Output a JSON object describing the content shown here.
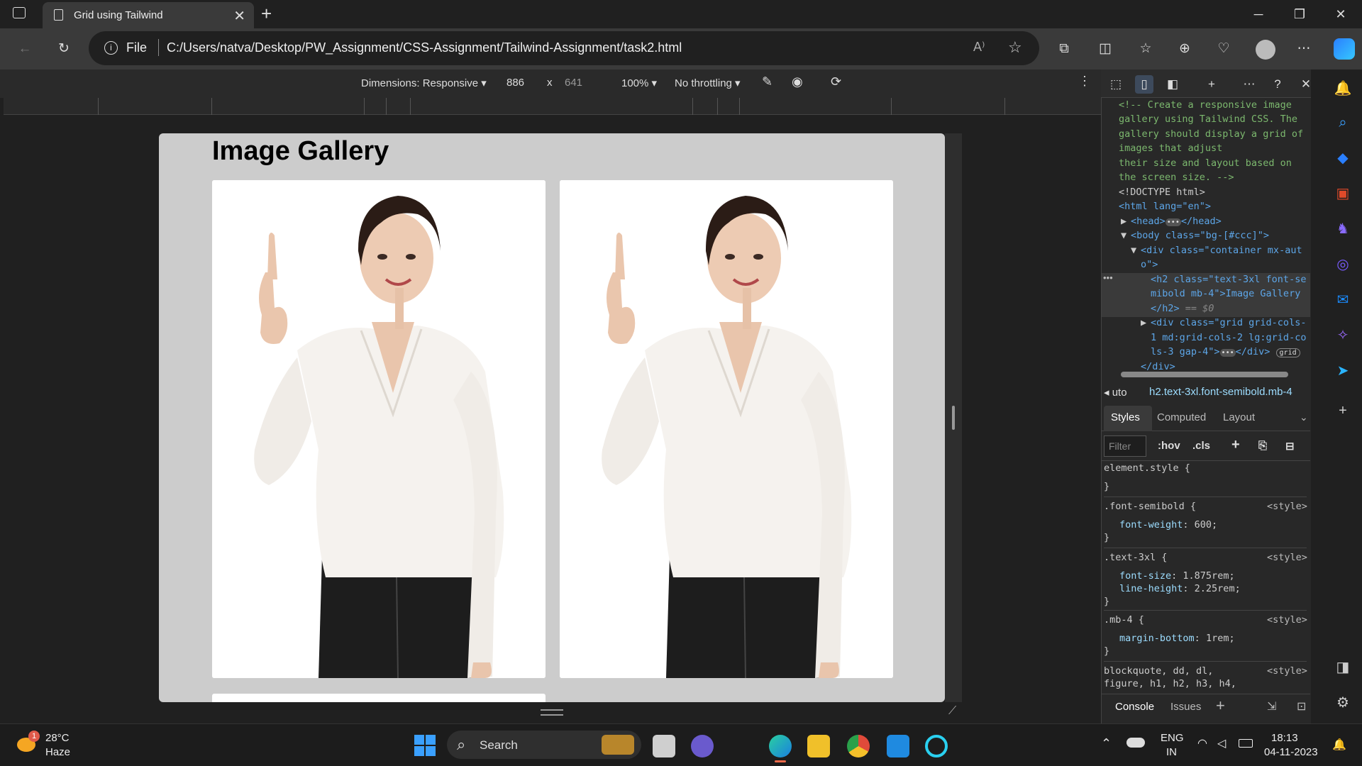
{
  "browser": {
    "tab_title": "Grid using Tailwind",
    "tab_close": "✕",
    "new_tab": "+",
    "file_label": "File",
    "url": "C:/Users/natva/Desktop/PW_Assignment/CSS-Assignment/Tailwind-Assignment/task2.html"
  },
  "device_toolbar": {
    "dimensions": "Dimensions: Responsive",
    "width": "886",
    "times": "x",
    "height": "641",
    "zoom": "100%",
    "throttling": "No throttling"
  },
  "page": {
    "title": "Image Gallery"
  },
  "devtools": {
    "code_lines": [
      "<!-- Create a responsive image",
      "gallery using Tailwind CSS. The",
      "gallery should display a grid of",
      "images that adjust",
      "their size and layout based on",
      "the screen size. -->"
    ],
    "doctype": "<!DOCTYPE html>",
    "html_tag": "<html lang=\"en\">",
    "head_tag": "<head>",
    "head_close": "</head>",
    "body_tag": "<body class=\"bg-[#ccc]\">",
    "div_tag_1": "<div class=\"container mx-aut",
    "div_tag_2": "o\">",
    "h2_line1": "<h2 class=\"text-3xl font-se",
    "h2_line2": "mibold mb-4\">Image Gallery",
    "h2_line3": "</h2>",
    "h2_eq": " == $0",
    "grid_line1": "<div class=\"grid grid-cols-",
    "grid_line2": "1 md:grid-cols-2 lg:grid-co",
    "grid_line3": "ls-3 gap-4\">",
    "grid_close": "</div>",
    "grid_badge": "grid",
    "div_close": "</div>",
    "crumb_left": "uto",
    "crumb_selector": "h2.text-3xl.font-semibold.mb-4",
    "tabs": [
      "Styles",
      "Computed",
      "Layout"
    ],
    "filter_placeholder": "Filter",
    "hov": ":hov",
    "cls": ".cls",
    "rules": {
      "element_style": "element.style {",
      "brace_close": "}",
      "font_semibold": ".font-semibold {",
      "font_weight": "font-weight",
      "font_weight_val": "600;",
      "text_3xl": ".text-3xl {",
      "font_size": "font-size",
      "font_size_val": "1.875rem;",
      "line_height": "line-height",
      "line_height_val": "2.25rem;",
      "mb_4": ".mb-4 {",
      "margin_bottom": "margin-bottom",
      "margin_bottom_val": "1rem;",
      "blockquote": "blockquote, dd, dl,",
      "figure": "figure, h1, h2, h3, h4,",
      "source": "<style>"
    },
    "console_tabs": [
      "Console",
      "Issues"
    ]
  },
  "taskbar": {
    "weather_temp": "28°C",
    "weather_desc": "Haze",
    "weather_badge": "1",
    "search_label": "Search",
    "lang_1": "ENG",
    "lang_2": "IN",
    "time": "18:13",
    "date": "04-11-2023"
  },
  "colors": {
    "page_bg": "#cccccc",
    "accent": "#0078d4"
  }
}
